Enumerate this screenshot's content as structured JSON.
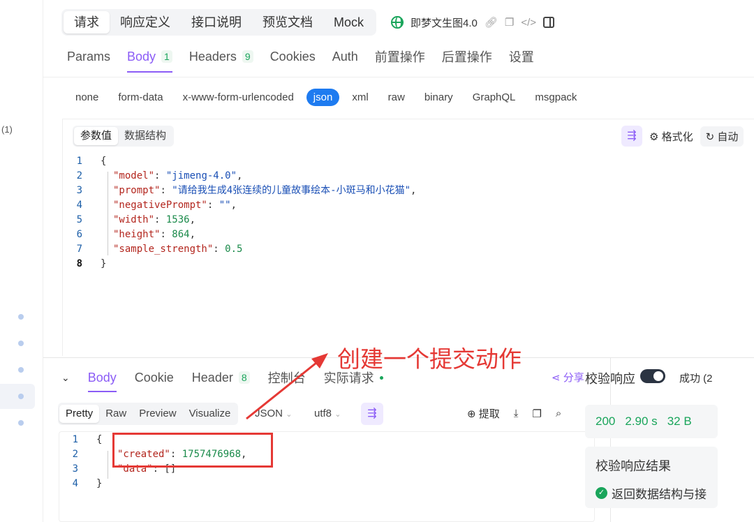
{
  "sidebar": {
    "count_text": "(1)"
  },
  "top_tabs": [
    "请求",
    "响应定义",
    "接口说明",
    "预览文档",
    "Mock"
  ],
  "api_name": "即梦文生图4.0",
  "request_tabs": [
    {
      "label": "Params",
      "badge": ""
    },
    {
      "label": "Body",
      "badge": "1"
    },
    {
      "label": "Headers",
      "badge": "9"
    },
    {
      "label": "Cookies",
      "badge": ""
    },
    {
      "label": "Auth",
      "badge": ""
    },
    {
      "label": "前置操作",
      "badge": ""
    },
    {
      "label": "后置操作",
      "badge": ""
    },
    {
      "label": "设置",
      "badge": ""
    }
  ],
  "body_types": [
    "none",
    "form-data",
    "x-www-form-urlencoded",
    "json",
    "xml",
    "raw",
    "binary",
    "GraphQL",
    "msgpack"
  ],
  "param_seg": [
    "参数值",
    "数据结构"
  ],
  "param_tools": {
    "format": "格式化",
    "auto": "自动"
  },
  "request_code": [
    {
      "ln": "1",
      "parts": [
        [
          "p",
          "{"
        ]
      ]
    },
    {
      "ln": "2",
      "parts": [
        [
          "k",
          "\"model\""
        ],
        [
          "p",
          ": "
        ],
        [
          "s",
          "\"jimeng-4.0\""
        ],
        [
          "p",
          ","
        ]
      ]
    },
    {
      "ln": "3",
      "parts": [
        [
          "k",
          "\"prompt\""
        ],
        [
          "p",
          ": "
        ],
        [
          "s",
          "\"请给我生成4张连续的儿童故事绘本-小斑马和小花猫\""
        ],
        [
          "p",
          ","
        ]
      ]
    },
    {
      "ln": "4",
      "parts": [
        [
          "k",
          "\"negativePrompt\""
        ],
        [
          "p",
          ": "
        ],
        [
          "s",
          "\"\""
        ],
        [
          "p",
          ","
        ]
      ]
    },
    {
      "ln": "5",
      "parts": [
        [
          "k",
          "\"width\""
        ],
        [
          "p",
          ": "
        ],
        [
          "n",
          "1536"
        ],
        [
          "p",
          ","
        ]
      ]
    },
    {
      "ln": "6",
      "parts": [
        [
          "k",
          "\"height\""
        ],
        [
          "p",
          ": "
        ],
        [
          "n",
          "864"
        ],
        [
          "p",
          ","
        ]
      ]
    },
    {
      "ln": "7",
      "parts": [
        [
          "k",
          "\"sample_strength\""
        ],
        [
          "p",
          ": "
        ],
        [
          "n",
          "0.5"
        ]
      ]
    },
    {
      "ln": "8",
      "parts": [
        [
          "p",
          "}"
        ]
      ]
    }
  ],
  "response_tabs": [
    {
      "label": "Body",
      "badge": ""
    },
    {
      "label": "Cookie",
      "badge": ""
    },
    {
      "label": "Header",
      "badge": "8"
    },
    {
      "label": "控制台",
      "badge": ""
    },
    {
      "label": "实际请求",
      "badge": ""
    }
  ],
  "share_label": "分享",
  "response_seg": [
    "Pretty",
    "Raw",
    "Preview",
    "Visualize"
  ],
  "response_format": "JSON",
  "response_encoding": "utf8",
  "extract_label": "提取",
  "response_code": [
    {
      "ln": "1",
      "parts": [
        [
          "p",
          "{"
        ]
      ]
    },
    {
      "ln": "2",
      "parts": [
        [
          "k",
          "\"created\""
        ],
        [
          "p",
          ": "
        ],
        [
          "n",
          "1757476968"
        ],
        [
          "p",
          ","
        ]
      ]
    },
    {
      "ln": "3",
      "parts": [
        [
          "k",
          "\"data\""
        ],
        [
          "p",
          ": []"
        ]
      ]
    },
    {
      "ln": "4",
      "parts": [
        [
          "p",
          "}"
        ]
      ]
    }
  ],
  "validate": {
    "title": "校验响应",
    "status": "成功 (2",
    "code": "200",
    "time": "2.90 s",
    "size": "32 B",
    "result_title": "校验响应结果",
    "result_text": "返回数据结构与接"
  },
  "annotation_text": "创建一个提交动作",
  "colors": {
    "accent": "#8b5cf6",
    "json_active": "#1e7bf0",
    "success": "#1aa55b",
    "annotation": "#e53935"
  }
}
